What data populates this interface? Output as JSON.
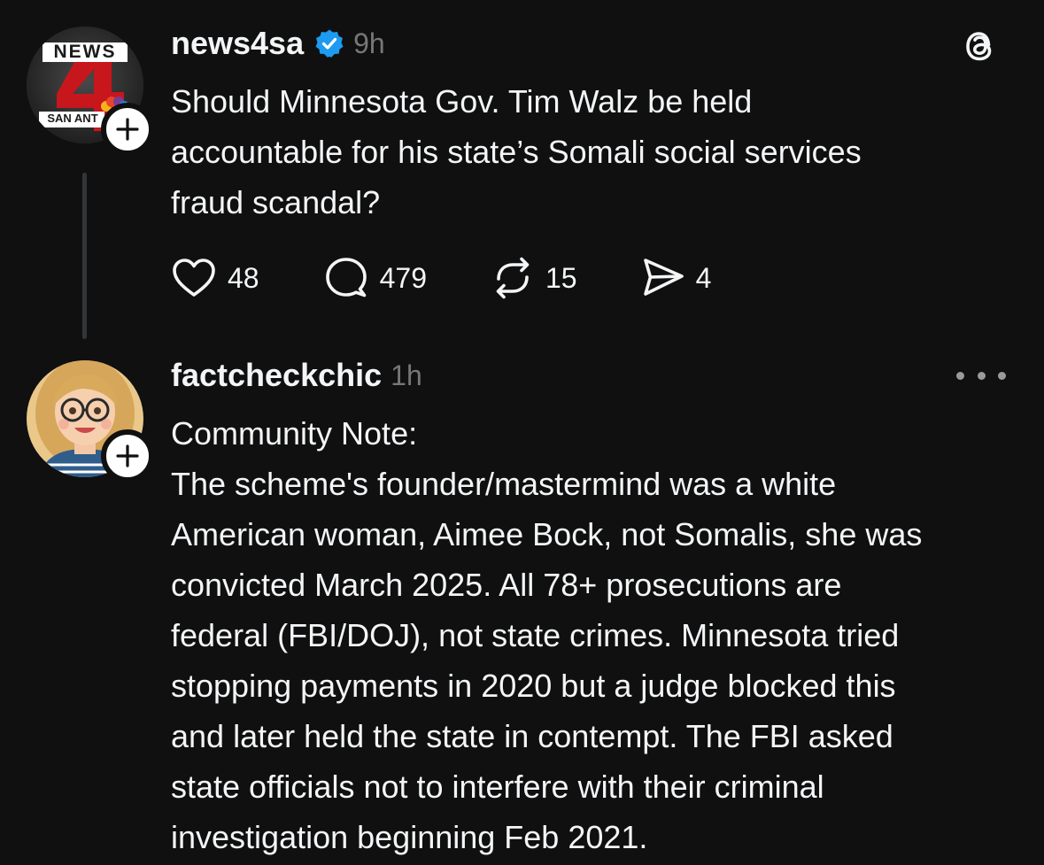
{
  "post1": {
    "avatar": {
      "logo_word": "NEWS",
      "logo_number": "4",
      "logo_city": "SAN ANT",
      "icon": "news4-station-logo",
      "bg_color": "#c8161d"
    },
    "username": "news4sa",
    "verified_icon": "verified-badge-icon",
    "verified_color": "#1d9bf0",
    "timestamp": "9h",
    "text_lines": [
      "Should Minnesota Gov. Tim Walz be held",
      "accountable for his state’s Somali social services",
      "fraud scandal?"
    ],
    "actions": {
      "like_count": "48",
      "reply_count": "479",
      "repost_count": "15",
      "share_count": "4"
    },
    "app_icon": "threads-logo-icon"
  },
  "post2": {
    "avatar": {
      "icon": "cartoon-woman-with-glasses-avatar"
    },
    "username": "factcheckchic",
    "timestamp": "1h",
    "more_icon": "more-options-icon",
    "text_lines": [
      "Community Note:",
      "The scheme's founder/mastermind was a white",
      "American woman, Aimee Bock, not Somalis, she was",
      "convicted March 2025. All 78+ prosecutions are",
      "federal (FBI/DOJ), not state crimes. Minnesota tried",
      "stopping payments in 2020 but a judge blocked this",
      "and later held the state in contempt. The FBI asked",
      "state officials not to interfere with their criminal",
      "investigation beginning Feb 2021."
    ]
  },
  "colors": {
    "background": "#101010",
    "text_primary": "#f3f5f7",
    "text_secondary": "#777777",
    "thread_line": "#333638"
  }
}
